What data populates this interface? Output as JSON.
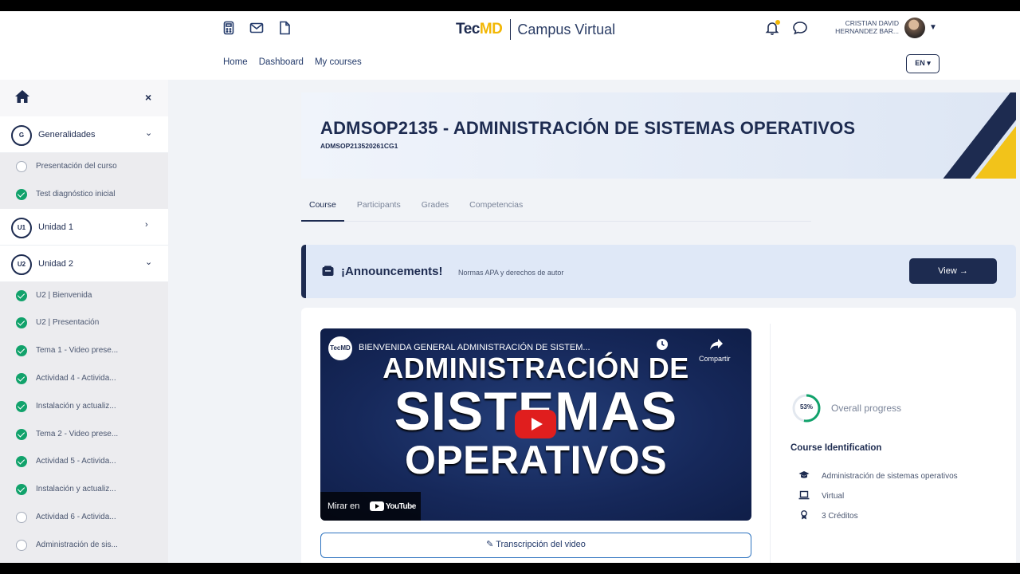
{
  "header": {
    "logo_tec": "Tec",
    "logo_md": "MD",
    "logo_site": "Campus Virtual",
    "nav": [
      "Home",
      "Dashboard",
      "My courses"
    ],
    "user_name_line1": "CRISTIAN DAVID",
    "user_name_line2": "HERNANDEZ BAR...",
    "language": "EN ▾"
  },
  "sidebar": {
    "sections": [
      {
        "badge": "G",
        "title": "Generalidades",
        "chevron": "⌄",
        "items": [
          {
            "label": "Presentación del curso",
            "done": false
          },
          {
            "label": "Test diagnóstico inicial",
            "done": true
          }
        ]
      },
      {
        "badge": "U1",
        "title": "Unidad 1",
        "chevron": "›"
      },
      {
        "badge": "U2",
        "title": "Unidad 2",
        "chevron": "⌄",
        "items": [
          {
            "label": "U2 | Bienvenida",
            "done": true
          },
          {
            "label": "U2 | Presentación",
            "done": true
          },
          {
            "label": "Tema 1 - Video prese...",
            "done": true
          },
          {
            "label": "Actividad 4 - Activida...",
            "done": true
          },
          {
            "label": "Instalación y actualiz...",
            "done": true
          },
          {
            "label": "Tema 2 - Video prese...",
            "done": true
          },
          {
            "label": "Actividad 5 - Activida...",
            "done": true
          },
          {
            "label": "Instalación y actualiz...",
            "done": true
          },
          {
            "label": "Actividad 6 - Activida...",
            "done": false
          },
          {
            "label": "Administración de sis...",
            "done": false
          }
        ]
      }
    ]
  },
  "course": {
    "title": "ADMSOP2135 - ADMINISTRACIÓN DE SISTEMAS OPERATIVOS",
    "code": "ADMSOP213520261CG1"
  },
  "tabs": [
    {
      "label": "Course",
      "active": true
    },
    {
      "label": "Participants",
      "active": false
    },
    {
      "label": "Grades",
      "active": false
    },
    {
      "label": "Competencias",
      "active": false
    }
  ],
  "announcement": {
    "title": "¡Announcements!",
    "text": "Normas APA y derechos de autor",
    "button": "View →"
  },
  "video": {
    "channel_logo": "TecMD",
    "title": "BIENVENIDA GENERAL ADMINISTRACIÓN DE SISTEM...",
    "share": "Compartir",
    "line1": "ADMINISTRACIÓN DE",
    "line2": "SISTEMAS",
    "line3": "OPERATIVOS",
    "watch_on": "Mirar en",
    "youtube": "YouTube"
  },
  "transcript_button": "Transcripción del video",
  "progress": {
    "percent": 53,
    "percent_label": "53%",
    "label": "Overall progress"
  },
  "identification": {
    "title": "Course Identification",
    "items": [
      {
        "icon": "graduation-cap-icon",
        "text": "Administración de sistemas operativos"
      },
      {
        "icon": "laptop-icon",
        "text": "Virtual"
      },
      {
        "icon": "award-icon",
        "text": "3 Créditos"
      }
    ]
  },
  "colors": {
    "navy": "#1d2b50",
    "yellow": "#f2c31a",
    "done_green": "#11a26b",
    "accent_blue": "#2f74c0"
  }
}
